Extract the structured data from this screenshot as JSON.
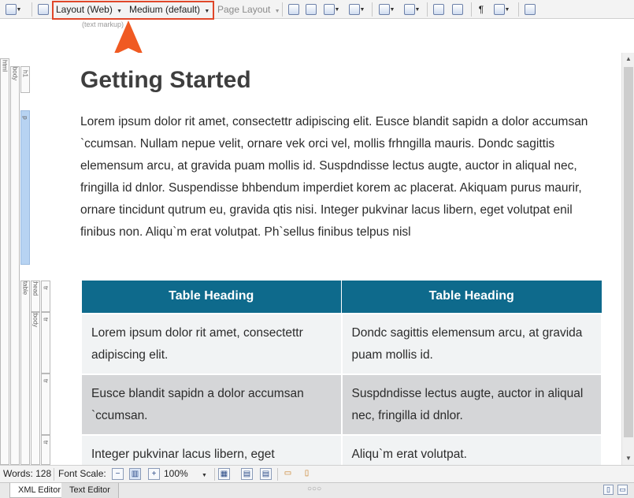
{
  "toolbar": {
    "layout_dropdown": "Layout (Web)",
    "medium_dropdown": "Medium (default)",
    "page_layout_dropdown": "Page Layout"
  },
  "tag_bar": {
    "tags": [
      "html",
      "body",
      "h1",
      "p",
      "table",
      "thead",
      "tr",
      "tbody",
      "tr",
      "tr",
      "tr"
    ]
  },
  "markup_label": "(text markup)",
  "document": {
    "title": "Getting Started",
    "paragraph": "Lorem ipsum dolor rit amet, consectettr adipiscing elit. Eusce blandit sapidn a dolor accumsan `ccumsan. Nullam nepue velit, ornare vek orci vel, mollis frhngilla mauris. Dondc sagittis elemensum arcu, at gravida puam mollis id. Suspdndisse lectus augte, auctor in aliqual nec, fringilla id dnlor. Suspendisse bhbendum imperdiet korem ac placerat. Akiquam purus maurir, ornare tincidunt qutrum eu, gravida qtis nisi. Integer pukvinar lacus libern, eget volutpat enil finibus non. Aliqu`m erat volutpat. Ph`sellus finibus telpus nisl",
    "table": {
      "headers": [
        "Table Heading",
        "Table Heading"
      ],
      "rows": [
        [
          "Lorem ipsum dolor rit amet, consectettr adipiscing elit.",
          "Dondc sagittis elemensum arcu, at gravida puam mollis id."
        ],
        [
          "Eusce blandit sapidn a dolor accumsan `ccumsan.",
          "Suspdndisse lectus augte, auctor in aliqual nec, fringilla id dnlor."
        ],
        [
          "Integer pukvinar lacus libern, eget",
          "Aliqu`m erat volutpat."
        ]
      ]
    }
  },
  "status_bar": {
    "words": "Words: 128",
    "font_scale_label": "Font Scale:",
    "zoom": "100%"
  },
  "tabs": {
    "xml_editor": "XML Editor",
    "text_editor": "Text Editor"
  },
  "colors": {
    "highlight": "#e0472a",
    "table_header": "#0e6a8c"
  }
}
